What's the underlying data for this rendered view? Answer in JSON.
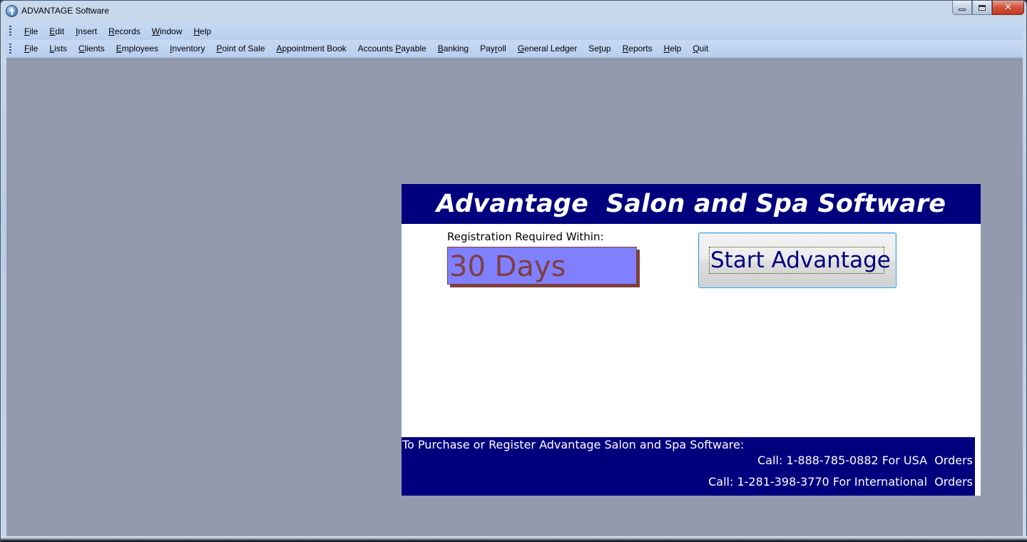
{
  "window": {
    "title": "ADVANTAGE Software",
    "controls": {
      "minimize_icon": "minimize-icon",
      "maximize_icon": "restore-icon",
      "close_icon": "close-icon",
      "close_glyph": "✕"
    }
  },
  "menubar_primary": {
    "items": [
      {
        "pre": "",
        "key": "F",
        "post": "ile"
      },
      {
        "pre": "",
        "key": "E",
        "post": "dit"
      },
      {
        "pre": "",
        "key": "I",
        "post": "nsert"
      },
      {
        "pre": "",
        "key": "R",
        "post": "ecords"
      },
      {
        "pre": "",
        "key": "W",
        "post": "indow"
      },
      {
        "pre": "",
        "key": "H",
        "post": "elp"
      }
    ]
  },
  "menubar_app": {
    "items": [
      {
        "pre": "",
        "key": "F",
        "post": "ile"
      },
      {
        "pre": "",
        "key": "L",
        "post": "ists"
      },
      {
        "pre": "",
        "key": "C",
        "post": "lients"
      },
      {
        "pre": "",
        "key": "E",
        "post": "mployees"
      },
      {
        "pre": "",
        "key": "I",
        "post": "nventory"
      },
      {
        "pre": "",
        "key": "P",
        "post": "oint of Sale"
      },
      {
        "pre": "",
        "key": "A",
        "post": "ppointment Book"
      },
      {
        "pre": "Accounts ",
        "key": "P",
        "post": "ayable"
      },
      {
        "pre": "",
        "key": "B",
        "post": "anking"
      },
      {
        "pre": "Pay",
        "key": "r",
        "post": "oll"
      },
      {
        "pre": "",
        "key": "G",
        "post": "eneral Ledger"
      },
      {
        "pre": "Se",
        "key": "t",
        "post": "up"
      },
      {
        "pre": "",
        "key": "R",
        "post": "eports"
      },
      {
        "pre": "",
        "key": "H",
        "post": "elp"
      },
      {
        "pre": "",
        "key": "Q",
        "post": "uit"
      }
    ]
  },
  "splash": {
    "title": "Advantage  Salon and Spa Software",
    "registration_label": "Registration Required Within:",
    "days_remaining": "30 Days",
    "start_button": "Start Advantage",
    "purchase_heading": "To Purchase or Register Advantage Salon and Spa Software:",
    "usa_line": "Call: 1-888-785-0882 For USA  Orders",
    "intl_line": "Call: 1-281-398-3770 For International  Orders"
  },
  "colors": {
    "header_navy": "#00007f",
    "days_box_bg": "#8080ff",
    "days_text": "#7f3f3f",
    "mdi_background": "#939aad",
    "menubar_bg": "#c6d9f3"
  }
}
